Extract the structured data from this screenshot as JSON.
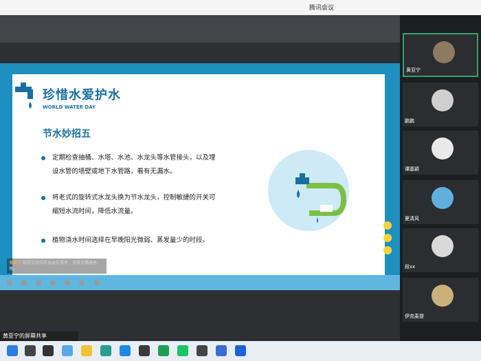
{
  "window": {
    "title": "腾讯会议"
  },
  "slide": {
    "title": "珍惜水爱护水",
    "subtitle": "WORLD WATER DAY",
    "heading": "节水妙招五",
    "bullets": [
      {
        "line1": "定期检查抽桶、水塔、水池、水龙头等水管接头，以及埋",
        "line2": "设水管的墙壁或地下水管路，看有无漏水。"
      },
      {
        "line1": "将老式的旋转式水龙头换为节水龙头，控制敏捷的开关可",
        "line2": "缩短水流时间，降低水流量。"
      },
      {
        "line1": "植物浇水时间选择在早晚阳光微弱、蒸发量少的时段。",
        "line2": ""
      }
    ]
  },
  "danmaku": {
    "name": "黄亚宁",
    "text": "知识点时间开水龙头洗手，洗漱水箱放水等。"
  },
  "share_label": "黄亚宁的屏幕共享",
  "participants": [
    {
      "name": "黄亚宁",
      "active": true
    },
    {
      "name": "鹏鹏"
    },
    {
      "name": "谭嘉颖"
    },
    {
      "name": "夏清风"
    },
    {
      "name": "段xx"
    },
    {
      "name": "伊克麦提"
    }
  ],
  "colors": {
    "accent": "#1a6fa0",
    "slide_bg": "#1f8fbf",
    "active_border": "#2fa56a"
  }
}
